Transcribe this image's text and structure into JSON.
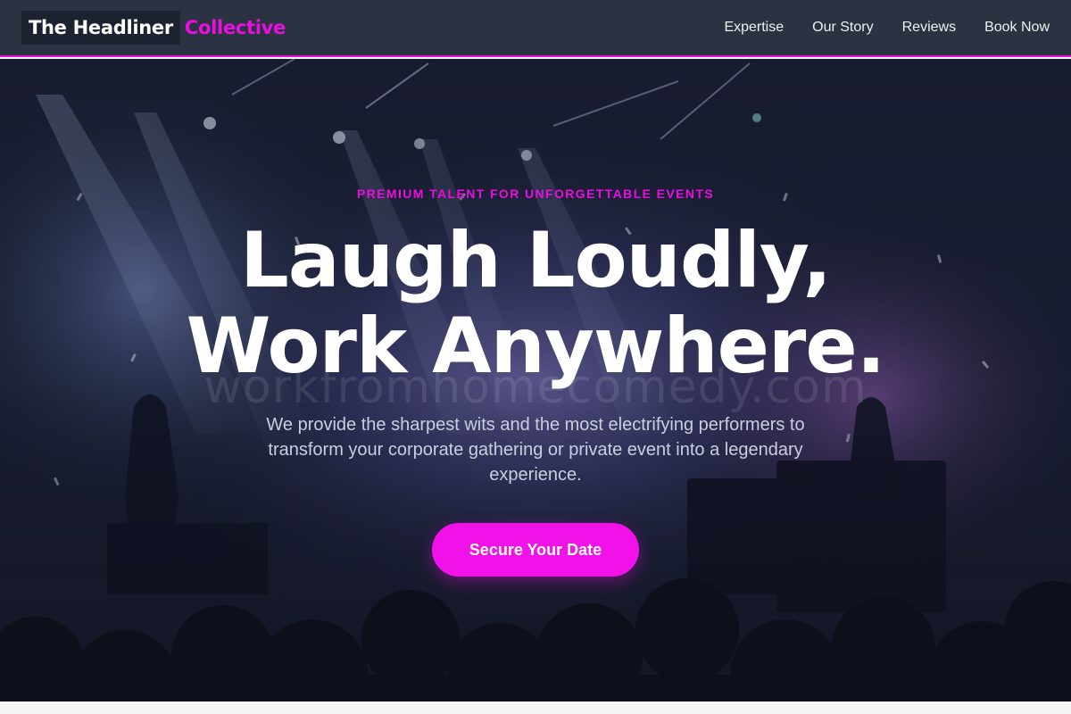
{
  "brand": {
    "name": "The Headliner",
    "accent": "Collective"
  },
  "nav": {
    "links": [
      "Expertise",
      "Our Story",
      "Reviews",
      "Book Now"
    ]
  },
  "hero": {
    "eyebrow": "PREMIUM TALENT FOR UNFORGETTABLE EVENTS",
    "headline_line1": "Laugh Loudly,",
    "headline_line2": "Work Anywhere.",
    "watermark": "workfromhomecomedy.com",
    "subtitle": "We provide the sharpest wits and the most electrifying performers to transform your corporate gathering or private event into a legendary experience.",
    "cta_label": "Secure Your Date"
  },
  "colors": {
    "accent": "#e80fe0",
    "nav_bg": "#2b3241",
    "hero_bg": "#171b2e",
    "text_light": "#ffffff"
  }
}
